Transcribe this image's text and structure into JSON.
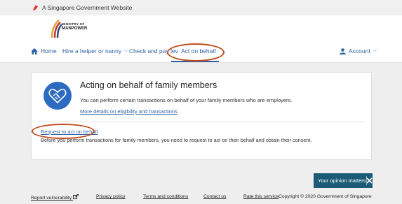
{
  "gov_bar": {
    "text": "A Singapore Government Website"
  },
  "header": {
    "logo_line1": "MINISTRY OF",
    "logo_line2": "MANPOWER"
  },
  "nav": {
    "home": "Home",
    "hire": "Hire a helper or nanny",
    "check_pay": "Check and pay lev",
    "act_on_behalf": "Act on behalf",
    "account": "Account"
  },
  "card": {
    "title": "Acting on behalf of family members",
    "description": "You can perform certain transactions on behalf of your family members who are employers.",
    "details_link": "More details on eligibility and transactions",
    "request_link": "Request to act on behalf",
    "note": "Before you perform transactions for family members, you need to request to act on their behalf and obtain their consent."
  },
  "feedback": {
    "label": "Your opinion matters"
  },
  "footer": {
    "report": "Report vulnerability",
    "privacy": "Privacy policy",
    "terms": "Terms and conditions",
    "contact": "Contact us",
    "rate": "Rate this service",
    "copyright": "Copyright © 2020 Government of Singapore"
  },
  "colors": {
    "accent": "#2e63a6",
    "annotation": "#c24a1c",
    "feedback_bg": "#1c5b75"
  }
}
